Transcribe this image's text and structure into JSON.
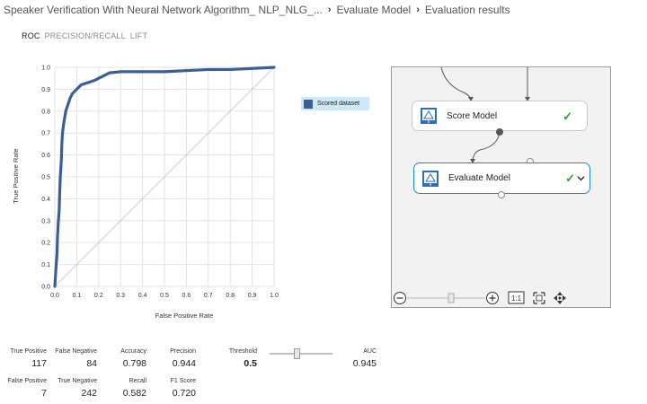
{
  "breadcrumb": {
    "experiment": "Speaker Verification With Neural Network Algorithm_ NLP_NLG_...",
    "module": "Evaluate Model",
    "page": "Evaluation results"
  },
  "tabs": [
    {
      "label": "ROC",
      "active": true
    },
    {
      "label": "PRECISION/RECALL",
      "active": false
    },
    {
      "label": "LIFT",
      "active": false
    }
  ],
  "chart_data": {
    "type": "line",
    "title": "",
    "xlabel": "False Positive Rate",
    "ylabel": "True Positive Rate",
    "xlim": [
      0,
      1
    ],
    "ylim": [
      0,
      1
    ],
    "xticks": [
      "0.0",
      "0.1",
      "0.2",
      "0.3",
      "0.4",
      "0.5",
      "0.6",
      "0.7",
      "0.8",
      "0.9",
      "1.0"
    ],
    "yticks": [
      "0.0",
      "0.1",
      "0.2",
      "0.3",
      "0.4",
      "0.5",
      "0.6",
      "0.7",
      "0.8",
      "0.9",
      "1.0"
    ],
    "grid": true,
    "legend_position": "right",
    "series": [
      {
        "name": "Scored dataset",
        "color": "#3b5f94",
        "x": [
          0,
          0.005,
          0.01,
          0.012,
          0.015,
          0.02,
          0.022,
          0.025,
          0.03,
          0.032,
          0.035,
          0.04,
          0.045,
          0.05,
          0.06,
          0.07,
          0.08,
          0.1,
          0.12,
          0.15,
          0.18,
          0.2,
          0.22,
          0.25,
          0.3,
          0.4,
          0.5,
          0.6,
          0.7,
          0.8,
          0.9,
          1.0
        ],
        "y": [
          0,
          0.08,
          0.15,
          0.22,
          0.28,
          0.35,
          0.42,
          0.5,
          0.58,
          0.65,
          0.7,
          0.74,
          0.77,
          0.8,
          0.83,
          0.86,
          0.88,
          0.9,
          0.92,
          0.93,
          0.94,
          0.95,
          0.96,
          0.975,
          0.98,
          0.98,
          0.98,
          0.985,
          0.99,
          0.99,
          0.995,
          1.0
        ]
      },
      {
        "name": "",
        "color": "#cccccc",
        "x": [
          0,
          1
        ],
        "y": [
          0,
          1
        ]
      }
    ]
  },
  "canvas": {
    "modules": [
      {
        "title": "Score Model",
        "status": "check-icon"
      },
      {
        "title": "Evaluate Model",
        "status": "check-icon",
        "selected": true
      }
    ],
    "zoom_reset_label": "1:1"
  },
  "metrics": {
    "true_positive": {
      "label": "True Positive",
      "value": "117"
    },
    "false_negative": {
      "label": "False Negative",
      "value": "84"
    },
    "accuracy": {
      "label": "Accuracy",
      "value": "0.798"
    },
    "precision": {
      "label": "Precision",
      "value": "0.944"
    },
    "threshold": {
      "label": "Threshold",
      "value": "0.5"
    },
    "auc": {
      "label": "AUC",
      "value": "0.945"
    },
    "false_positive": {
      "label": "False Positive",
      "value": "7"
    },
    "true_negative": {
      "label": "True Negative",
      "value": "242"
    },
    "recall": {
      "label": "Recall",
      "value": "0.582"
    },
    "f1_score": {
      "label": "F1 Score",
      "value": "0.720"
    }
  },
  "colors": {
    "accent": "#1c8ad3",
    "series": "#3b5f94",
    "success": "#2aa32a"
  }
}
